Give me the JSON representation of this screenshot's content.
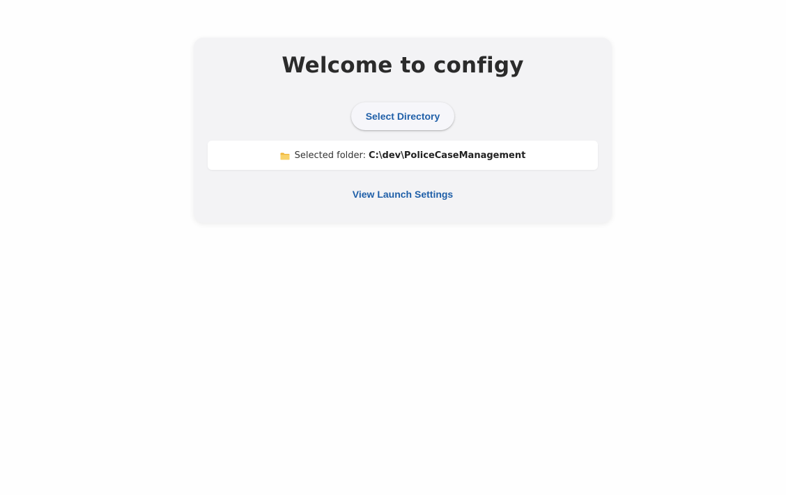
{
  "card": {
    "title": "Welcome to configy",
    "select_button_label": "Select Directory",
    "folder": {
      "icon": "folder-icon",
      "label": "Selected folder:",
      "path": "C:\\dev\\PoliceCaseManagement"
    },
    "launch_link_label": "View Launch Settings"
  },
  "colors": {
    "accent": "#1f5fa8",
    "card_background": "#f3f3f5",
    "folder_icon": "#f5c64a"
  }
}
